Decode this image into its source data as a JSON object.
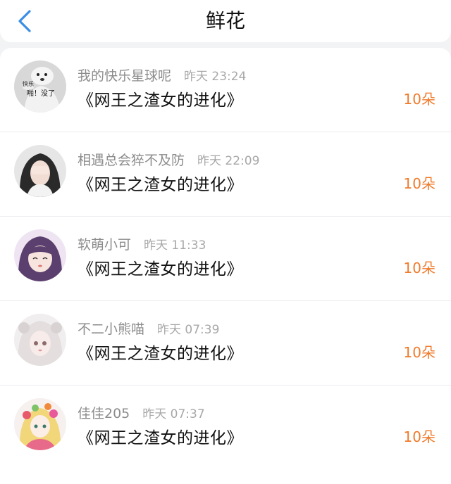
{
  "header": {
    "title": "鲜花",
    "back_icon": "chevron-left-icon",
    "accent_color": "#3a8ee6"
  },
  "colors": {
    "count": "#f07a2a",
    "name": "#8c8c8c",
    "time": "#a8a8a8"
  },
  "records": [
    {
      "avatar_icon": "puppy-avatar-icon",
      "avatar_text": "快乐 啪！没了",
      "name": "我的快乐星球呢",
      "time": "昨天 23:24",
      "book": "《网王之渣女的进化》",
      "count": "10朵"
    },
    {
      "avatar_icon": "girl-covering-face-avatar-icon",
      "name": "相遇总会猝不及防",
      "time": "昨天 22:09",
      "book": "《网王之渣女的进化》",
      "count": "10朵"
    },
    {
      "avatar_icon": "anime-girl-avatar-icon",
      "name": "软萌小可",
      "time": "昨天 11:33",
      "book": "《网王之渣女的进化》",
      "count": "10朵"
    },
    {
      "avatar_icon": "white-hair-girl-avatar-icon",
      "name": "不二小熊喵",
      "time": "昨天 07:39",
      "book": "《网王之渣女的进化》",
      "count": "10朵"
    },
    {
      "avatar_icon": "flower-fairy-avatar-icon",
      "name": "佳佳205",
      "time": "昨天 07:37",
      "book": "《网王之渣女的进化》",
      "count": "10朵"
    }
  ]
}
